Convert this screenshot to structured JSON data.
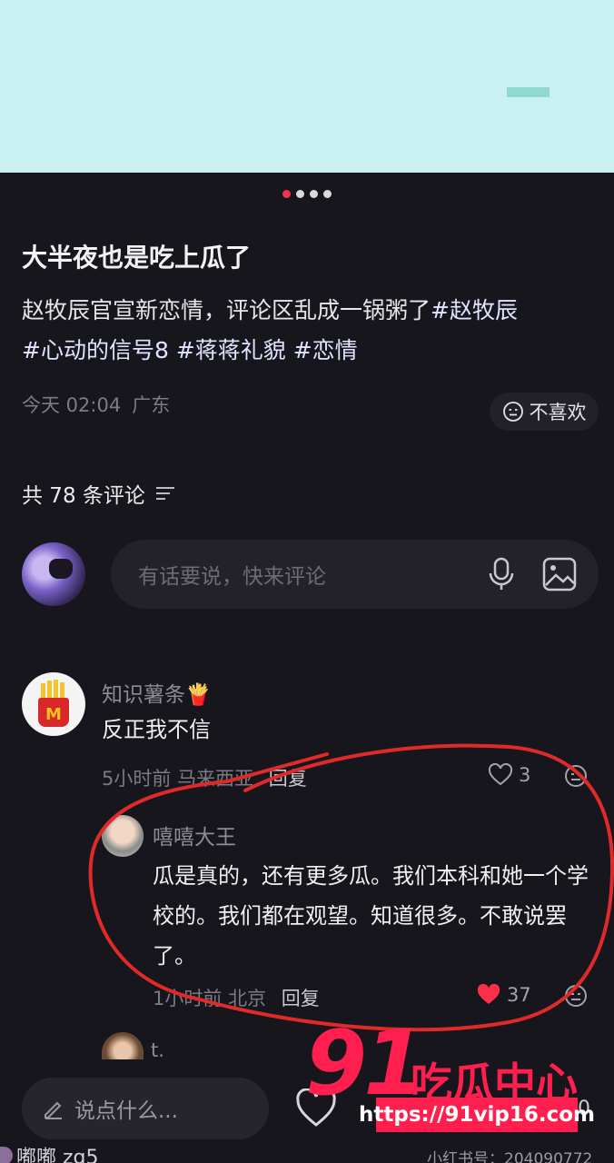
{
  "carousel": {
    "total": 4,
    "active_index": 0
  },
  "post": {
    "title": "大半夜也是吃上瓜了",
    "description": "赵牧辰官宣新恋情，评论区乱成一锅粥了",
    "tags": [
      "#赵牧辰",
      "#心动的信号8",
      "#蒋蒋礼貌",
      "#恋情"
    ],
    "time": "今天 02:04",
    "location": "广东",
    "dislike_label": "不喜欢"
  },
  "comments_header": {
    "label": "共 78 条评论"
  },
  "comment_input": {
    "placeholder": "有话要说，快来评论"
  },
  "comments": [
    {
      "user": "知识薯条🍟",
      "text": "反正我不信",
      "time": "5小时前",
      "location": "马来西亚",
      "reply_label": "回复",
      "likes": "3"
    },
    {
      "user": "嘻嘻大王",
      "text": "瓜是真的，还有更多瓜。我们本科和她一个学校的。我们都在观望。知道很多。不敢说罢了。",
      "time": "1小时前",
      "location": "北京",
      "reply_label": "回复",
      "likes": "37",
      "liked": true
    },
    {
      "user": "t."
    }
  ],
  "bottom_bar": {
    "input_placeholder": "说点什么...",
    "right_count": "0"
  },
  "watermark": {
    "number": "91",
    "text": "吃瓜中心",
    "url": "https://91vip16.com"
  },
  "footer": {
    "username": "嘟嘟 zg5",
    "platform_id": "小红书号：204090772"
  },
  "colors": {
    "accent_red": "#ff1f4f",
    "background": "#17161c",
    "top_image": "#c9f1f2"
  }
}
